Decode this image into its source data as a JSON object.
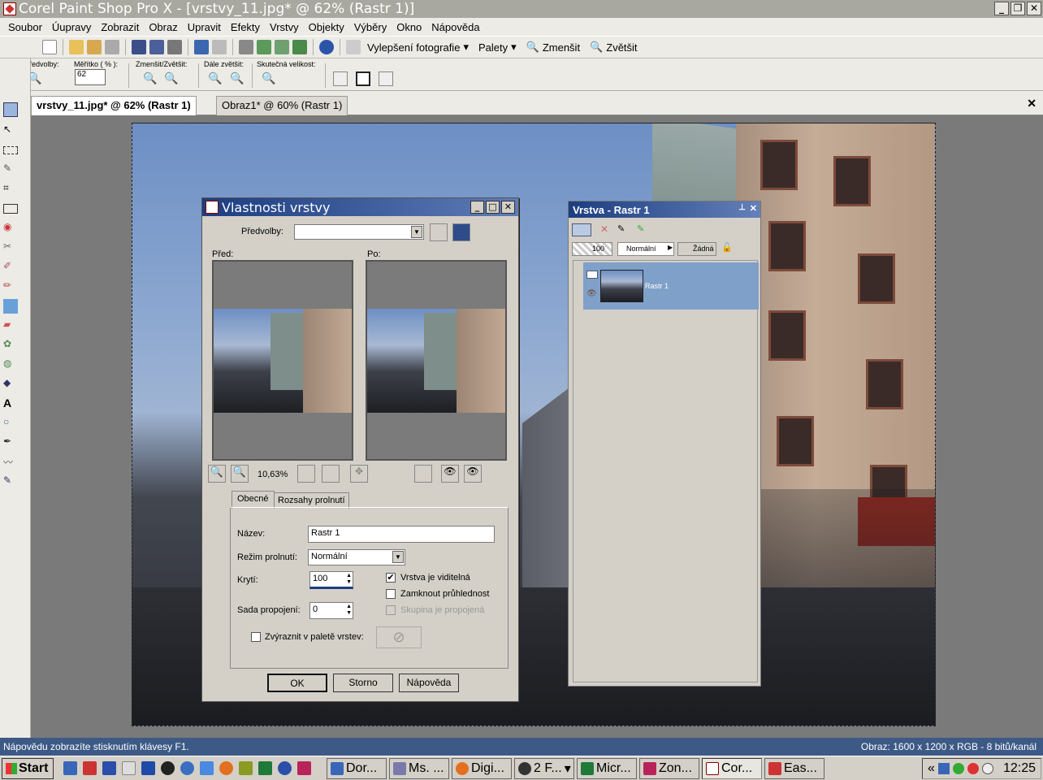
{
  "app": {
    "title": "Corel Paint Shop Pro X - [vrstvy_11.jpg* @  62% (Rastr 1)]",
    "window_buttons": [
      "_",
      "❐",
      "✕"
    ]
  },
  "menu": [
    "Soubor",
    "Úupravy",
    "Zobrazit",
    "Obraz",
    "Upravit",
    "Efekty",
    "Vrstvy",
    "Objekty",
    "Výběry",
    "Okno",
    "Nápověda"
  ],
  "toolbar": {
    "enhance_photo": "Vylepšení fotografie",
    "palettes": "Palety",
    "zoom_out": "Zmenšit",
    "zoom_in": "Zvětšit"
  },
  "options": {
    "presets_label": "Předvolby:",
    "scale_label": "Měřítko ( % ):",
    "scale_value": "62",
    "zoom_in_out_label": "Zmenšit/Zvětšit:",
    "zoom_more_label": "Dále zvětšit:",
    "actual_size_label": "Skutečná velikost:"
  },
  "tabs": {
    "active": "vrstvy_11.jpg* @  62% (Rastr 1)",
    "other": "Obraz1* @  60% (Rastr 1)",
    "close": "✕"
  },
  "dialog": {
    "title": "Vlastnosti vrstvy",
    "presets_label": "Předvolby:",
    "before_label": "Před:",
    "after_label": "Po:",
    "zoom_percent": "10,63%",
    "tab_general": "Obecné",
    "tab_blend_ranges": "Rozsahy prolnutí",
    "name_label": "Název:",
    "name_value": "Rastr 1",
    "blend_mode_label": "Režim prolnutí:",
    "blend_mode_value": "Normální",
    "opacity_label": "Krytí:",
    "opacity_value": "100",
    "link_set_label": "Sada propojení:",
    "link_set_value": "0",
    "visible_label": "Vrstva je viditelná",
    "visible_checked": true,
    "lock_transparency_label": "Zamknout průhlednost",
    "group_linked_label": "Skupina je propojená",
    "highlight_label": "Zvýraznit v paletě vrstev:",
    "ok": "OK",
    "cancel": "Storno",
    "help": "Nápověda"
  },
  "layers_palette": {
    "title": "Vrstva - Rastr 1",
    "opacity": "100",
    "blend": "Normální",
    "mask": "Žádná",
    "layer_name": "Rastr 1"
  },
  "status": {
    "help_text": "Nápovědu zobrazíte stisknutím klávesy F1.",
    "image_info": "Obraz:  1600 x 1200 x RGB - 8 bitů/kanál"
  },
  "taskbar": {
    "start": "Start",
    "tasks": [
      "Dor...",
      "Ms. ...",
      "Digi...",
      "2 F...",
      "Micr...",
      "Zon...",
      "Cor...",
      "Eas..."
    ],
    "clock": "12:25",
    "tray_chevron": "«"
  },
  "colors": {
    "title_active": "#1c3d80",
    "status_bar": "#3d5a86",
    "layer_selected": "#7fa0c8"
  }
}
